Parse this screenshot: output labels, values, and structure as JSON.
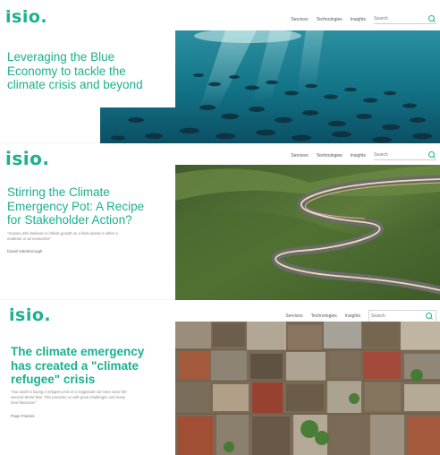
{
  "cards": [
    {
      "logo": "isio.",
      "nav": [
        "Services",
        "Technologies",
        "Insights"
      ],
      "search_placeholder": "Search",
      "headline": "Leveraging the Blue Economy to tackle the climate crisis and beyond",
      "image": "ocean-fish-school"
    },
    {
      "logo": "isio.",
      "nav": [
        "Services",
        "Technologies",
        "Insights"
      ],
      "search_placeholder": "Search",
      "headline": "Stirring the Climate Emergency Pot: A Recipe for Stakeholder Action?",
      "quote": "\"Anyone who believes in infinite growth on a finite planet is either a madman or an economist\"",
      "author": "David Attenborough",
      "image": "winding-road-hills"
    },
    {
      "logo": "isio.",
      "nav": [
        "Services",
        "Technologies",
        "Insights"
      ],
      "search_placeholder": "Search",
      "headline": "The climate emergency has created a \"climate refugee\" crisis",
      "quote": "\"Our world is facing a refugee crisis of a magnitude not seen since the Second World War. This presents us with great challenges and many hard decisions\"",
      "author": "Pope Francis",
      "image": "aerial-informal-settlement"
    }
  ],
  "colors": {
    "brand": "#1bb08f",
    "text": "#2a2a2a"
  }
}
